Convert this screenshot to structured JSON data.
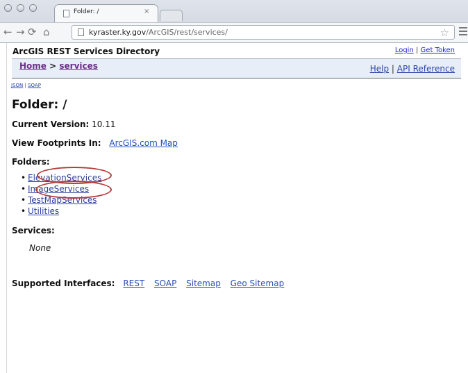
{
  "browser": {
    "tab": {
      "title": "Folder: /",
      "close": "×"
    },
    "url": {
      "domain": "kyraster.ky.gov",
      "path": "/ArcGIS/rest/services/"
    }
  },
  "directory": {
    "title": "ArcGIS REST Services Directory",
    "login": "Login",
    "separator": "|",
    "get_token": "Get Token"
  },
  "bar": {
    "home": "Home",
    "arrow": ">",
    "services": "services",
    "help": "Help",
    "separator": "|",
    "api_reference": "API Reference"
  },
  "formats": {
    "json": "JSON",
    "separator": "|",
    "soap": "SOAP"
  },
  "page": {
    "title": "Folder: /",
    "current_version_label": "Current Version:",
    "current_version_value": "10.11",
    "view_footprints_label": "View Footprints In:",
    "view_footprints_link": "ArcGIS.com Map",
    "folders_heading": "Folders:",
    "folders": [
      "ElevationServices",
      "ImageServices",
      "TestMapServices",
      "Utilities"
    ],
    "services_heading": "Services:",
    "services_value": "None",
    "supported_interfaces_label": "Supported Interfaces:",
    "interfaces": [
      "REST",
      "SOAP",
      "Sitemap",
      "Geo Sitemap"
    ]
  }
}
